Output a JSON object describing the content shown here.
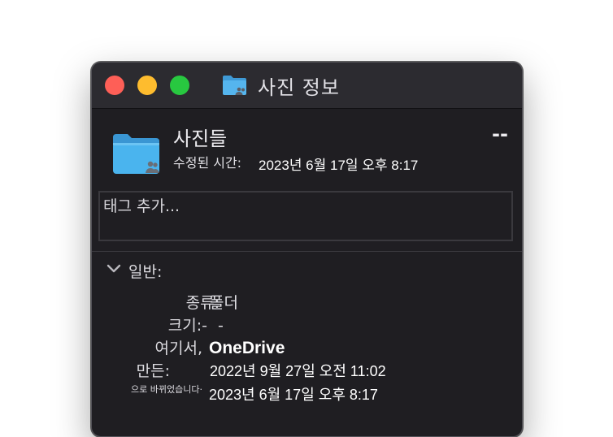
{
  "window": {
    "title": "사진 정보",
    "accent_colors": {
      "close": "#fe5f57",
      "minimize": "#febc2e",
      "zoom": "#28c840",
      "folder": "#4ab0ec"
    }
  },
  "header": {
    "name": "사진들",
    "size": "--",
    "modified_label": "수정된 시간:",
    "modified_value": "2023년 6월 17일 오후 8:17"
  },
  "tags": {
    "placeholder": "태그 추가..."
  },
  "general": {
    "section_title": "일반:",
    "kind_label": "종류:",
    "kind_value": "폴더",
    "size_label": "크기:-",
    "size_value": "-",
    "where_label": "여기서,",
    "where_value": "OneDrive",
    "created_label": "만든:",
    "created_value": "2022년 9월 27일 오전 11:02",
    "modified_label": "으로 바뀌었습니다·",
    "modified_value": "2023년 6월 17일 오후 8:17"
  },
  "icons": {
    "title_folder": "shared-folder-icon",
    "large_folder": "shared-folder-icon",
    "disclosure": "chevron-down-icon"
  }
}
